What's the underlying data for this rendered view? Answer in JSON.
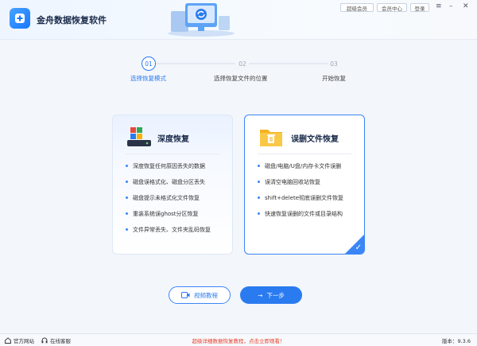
{
  "app": {
    "title": "金舟数据恢复软件"
  },
  "topbar": {
    "vip_label": "超级会员",
    "member_center_label": "会员中心",
    "login_label": "登录",
    "window_controls": [
      "menu-icon",
      "minimize-icon",
      "close-icon"
    ]
  },
  "steps": [
    {
      "number": "01",
      "label": "选择恢复模式",
      "active": true
    },
    {
      "number": "02",
      "label": "选择恢复文件的位置",
      "active": false
    },
    {
      "number": "03",
      "label": "开始恢复",
      "active": false
    }
  ],
  "cards": [
    {
      "title": "深度恢复",
      "icon": "windows-drive-icon",
      "features": [
        "深度恢复任何原因丢失的数据",
        "磁盘误格式化、磁盘分区丢失",
        "磁盘提示未格式化文件恢复",
        "重装系统误ghost分区恢复",
        "文件异常丢失、文件夹乱码恢复"
      ],
      "selected": false
    },
    {
      "title": "误删文件恢复",
      "icon": "recycle-folder-icon",
      "features": [
        "磁盘/电脑/U盘/内存卡文件误删",
        "误清空电脑回收站恢复",
        "shift+delete彻底误删文件恢复",
        "快速恢复误删的文件或目录结构"
      ],
      "selected": true
    }
  ],
  "buttons": {
    "video_label": "视频教程",
    "next_label": "下一步"
  },
  "footer": {
    "website_label": "官方网站",
    "service_label": "在线客服",
    "promo_text": "超级详细数据恢复教程，点击立即观看！",
    "version_text": "版本：9.3.6"
  },
  "colors": {
    "accent": "#2a7bf0",
    "promo": "#e8402c"
  }
}
